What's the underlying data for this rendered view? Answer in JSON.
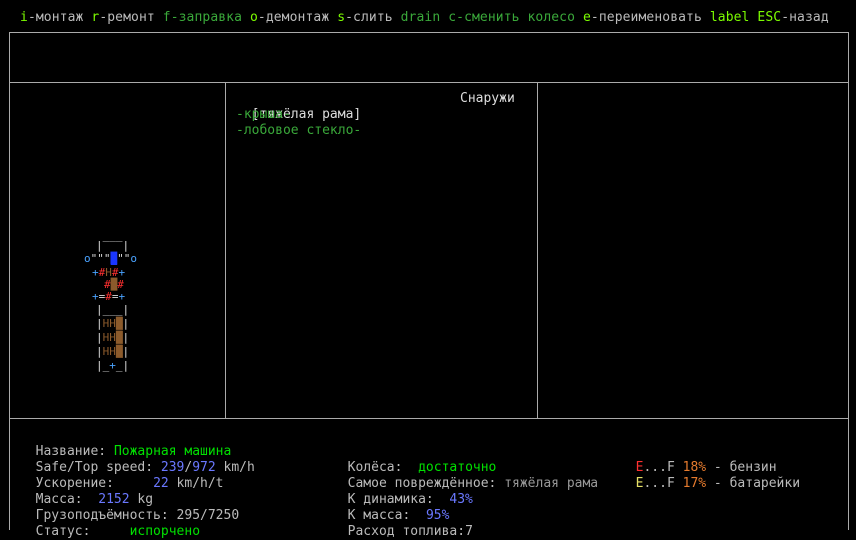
{
  "hints": [
    {
      "key": "i",
      "text": "-монтаж"
    },
    {
      "key": "r",
      "text": "-ремонт"
    },
    {
      "key": "f",
      "text": "-заправка",
      "dim": true
    },
    {
      "key": "o",
      "text": "-демонтаж"
    },
    {
      "key": "s",
      "text": "-слить"
    },
    {
      "key": "drain",
      "text": "",
      "dim": true
    },
    {
      "key": "c",
      "text": "-сменить колесо",
      "dim": true
    },
    {
      "key": "e",
      "text": "-переименовать"
    },
    {
      "key": "label",
      "text": ""
    },
    {
      "key": "ESC",
      "text": "-назад"
    }
  ],
  "parts_panel": {
    "header_part": "[тяжёлая рама]",
    "header_location": "Снаружи",
    "items": [
      "-крыша-",
      "-лобовое стекло-"
    ]
  },
  "info": {
    "name_label": "Название: ",
    "name_value": "Пожарная машина",
    "speed_label": "Safe/Top speed: ",
    "speed_safe": "239",
    "speed_top": "972",
    "speed_unit": " km/h",
    "accel_label": "Ускорение:     ",
    "accel_value": "22",
    "accel_unit": " km/h/t",
    "mass_label": "Масса:  ",
    "mass_value": "2152",
    "mass_unit": " kg",
    "cargo_label": "Грузоподъёмность: ",
    "cargo_value": "295/7250",
    "status_label": "Статус:     ",
    "status_value": "испорчено",
    "wheels_label": "Колёса:  ",
    "wheels_value": "достаточно",
    "damaged_label": "Самое повреждённое: ",
    "damaged_value": "тяжёлая рама",
    "k_dyn_label": "К динамика:  ",
    "k_dyn_value": "43%",
    "k_mass_label": "К масса:  ",
    "k_mass_value": "95%",
    "fuel_use_label": "Расход топлива:",
    "fuel_use_value": "7",
    "tank1_gauge_e": "E",
    "tank1_gauge_mid": "...F ",
    "tank1_pct": "18%",
    "tank1_name": " - бензин",
    "tank2_gauge_e": "E",
    "tank2_gauge_mid": "...F ",
    "tank2_pct": "17%",
    "tank2_name": " - батарейки"
  },
  "colors": {
    "key_hint": "#7cfc00",
    "frame": "#aaaaaa",
    "part_item": "#3aa83a",
    "good_value": "#00e000",
    "number_value": "#6a78ff"
  }
}
